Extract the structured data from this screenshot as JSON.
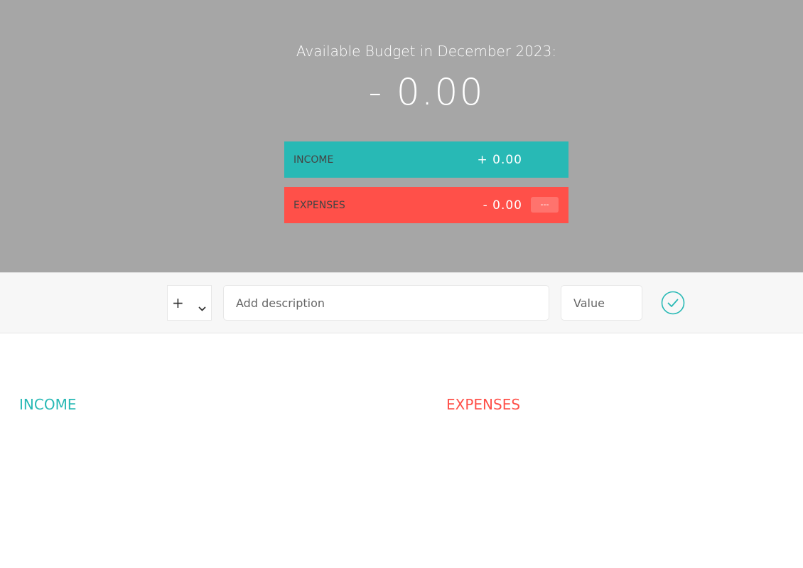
{
  "header": {
    "title": "Available Budget in December 2023:",
    "value": "- 0.00"
  },
  "summary": {
    "income": {
      "label": "INCOME",
      "value": "+ 0.00"
    },
    "expenses": {
      "label": "EXPENSES",
      "value": "- 0.00",
      "percentage": "---"
    }
  },
  "add_form": {
    "type_value": "+",
    "description_placeholder": "Add description",
    "value_placeholder": "Value",
    "submit_icon": "checkmark-circle-icon"
  },
  "lists": {
    "income_title": "INCOME",
    "expenses_title": "EXPENSES"
  },
  "colors": {
    "header_bg": "#a6a6a6",
    "income": "#28b9b5",
    "expenses": "#ff5049",
    "form_bg": "#f7f7f7"
  }
}
